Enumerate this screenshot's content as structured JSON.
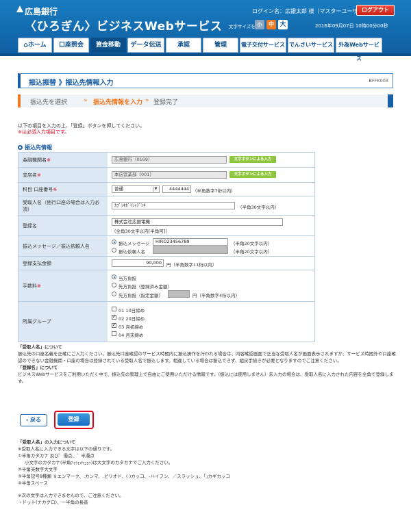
{
  "header": {
    "bank_name": "広島銀行",
    "service_name": "〈ひろぎん〉ビジネスWebサービス",
    "login_label": "ログイン名：広銀太郎 様（マスターユーザ）",
    "logout": "ログアウト",
    "fontsize_label": "文字サイズを変更",
    "fontsize_small": "小",
    "fontsize_medium": "中",
    "fontsize_large": "大",
    "datetime": "2016年09月07日 10時00分00秒"
  },
  "nav": [
    {
      "label": "ホーム"
    },
    {
      "label": "口座照会"
    },
    {
      "label": "資金移動"
    },
    {
      "label": "データ伝送"
    },
    {
      "label": "承認"
    },
    {
      "label": "管理"
    },
    {
      "label": "電子交付サービス"
    },
    {
      "label": "でんさいサービス"
    },
    {
      "label": "外為Webサービス"
    }
  ],
  "page": {
    "title": "振込振替 》振込先情報入力",
    "screen_id": "BFFK003"
  },
  "steps": {
    "step1": "振込先を選択",
    "step2": "振込先情報を入力",
    "step3": "登録完了",
    "arrow": "»"
  },
  "instructions": {
    "line1": "以下の項目を入力の上、「登録」ボタンを押してください。",
    "line2": "※は必須入力項目です。"
  },
  "section": {
    "title": "振込先情報"
  },
  "form": {
    "bank": {
      "label": "金融機関名",
      "value": "広島銀行（0169）",
      "button": "文字ボタンによる入力"
    },
    "branch": {
      "label": "支店名",
      "value": "本店営業部（001）",
      "button": "文字ボタンによる入力"
    },
    "account": {
      "label": "科目 口座番号",
      "type": "普通",
      "number": "4444444",
      "note": "（半角数字7桁以内）"
    },
    "payee": {
      "label": "受取人名（他行口座の場合は入力必須）",
      "value": "ｶﾌﾞｼｷｶﾞｲｼｬﾃﾞﾝｷ",
      "note": "（半角30文字以内）"
    },
    "registered_name": {
      "label": "登録名",
      "value": "株式会社広銀電機",
      "note": "（全角30文字以内[半角可]）"
    },
    "message": {
      "label": "振込メッセージ／振込依頼人名",
      "opt1": "振込メッセージ",
      "opt1_value": "HIRO23456789",
      "opt1_note": "（半角20文字以内）",
      "opt2": "振込依頼人名",
      "opt2_note": "（半角20文字以内）"
    },
    "amount": {
      "label": "登録支払金額",
      "value": "90,000",
      "note": "円（半角数字11桁以内）"
    },
    "fee": {
      "label": "手数料",
      "opt1": "当方負担",
      "opt2": "先方負担（登録済み金額）",
      "opt3": "先方負担（指定金額）",
      "opt3_note": "円（半角数字4桁以内）"
    },
    "group": {
      "label": "所属グループ",
      "items": [
        {
          "label": "01 10日締め",
          "checked": false
        },
        {
          "label": "02 20日締め",
          "checked": true
        },
        {
          "label": "03 月初締め",
          "checked": true
        },
        {
          "label": "04 月末締め",
          "checked": false
        }
      ]
    },
    "required_mark": "※"
  },
  "notes": {
    "h1": "「受取人名」について",
    "p1": "振込先の口座名義を正確にご入力ください。振込先口座確認のサービス時間内に振込操作を行われる場合は、内容確認画面で正当な受取人名が画面表示されますが、サービス時間外や口座確認のできない金融機関・口座の場合は登録されている受取人名で振込します。相違している場合は振込できず、組戻手続きが必要となりますのでご注意ください。",
    "h2": "「登録名」について",
    "p2": "ビジネスWebサービスをご利用いただく中で、振込先の管理上で自由にご使用いただける情報です。(振込には使用しません）未入力の場合は、受取人名に入力された内容を全角で登録します。"
  },
  "buttons": {
    "back": "戻る",
    "register": "登録"
  },
  "footer_notes": {
    "h": "「受取人名」の入力について",
    "l1": "※受取人名に入力できる文字は以下の通りです。",
    "l2": "①半角カタカナ 及び゛濁点、゜半濁点",
    "l3": "小文字のカタカナ(半角ｧｨｩｪｫｬｭｮｯ)は大文字のカタカナでご入力ください。",
    "l4": "②半角英数字大文字",
    "l5": "③半角記号8種類 ￥エンマーク、.カンマ、.ピリオド、( )カッコ、-ハイフン、／スラッシュ、｢｣カギカッコ",
    "l6": "④半角スペース",
    "l7": "※次の文字は入力できませんので、ご注意ください。",
    "l8": "・ドット(ナカグロ)、一半角の長音"
  },
  "colors": {
    "header": "#1a7cc0",
    "accent": "#f07820",
    "required": "#e0001a",
    "label_bg": "#dce8f3"
  }
}
